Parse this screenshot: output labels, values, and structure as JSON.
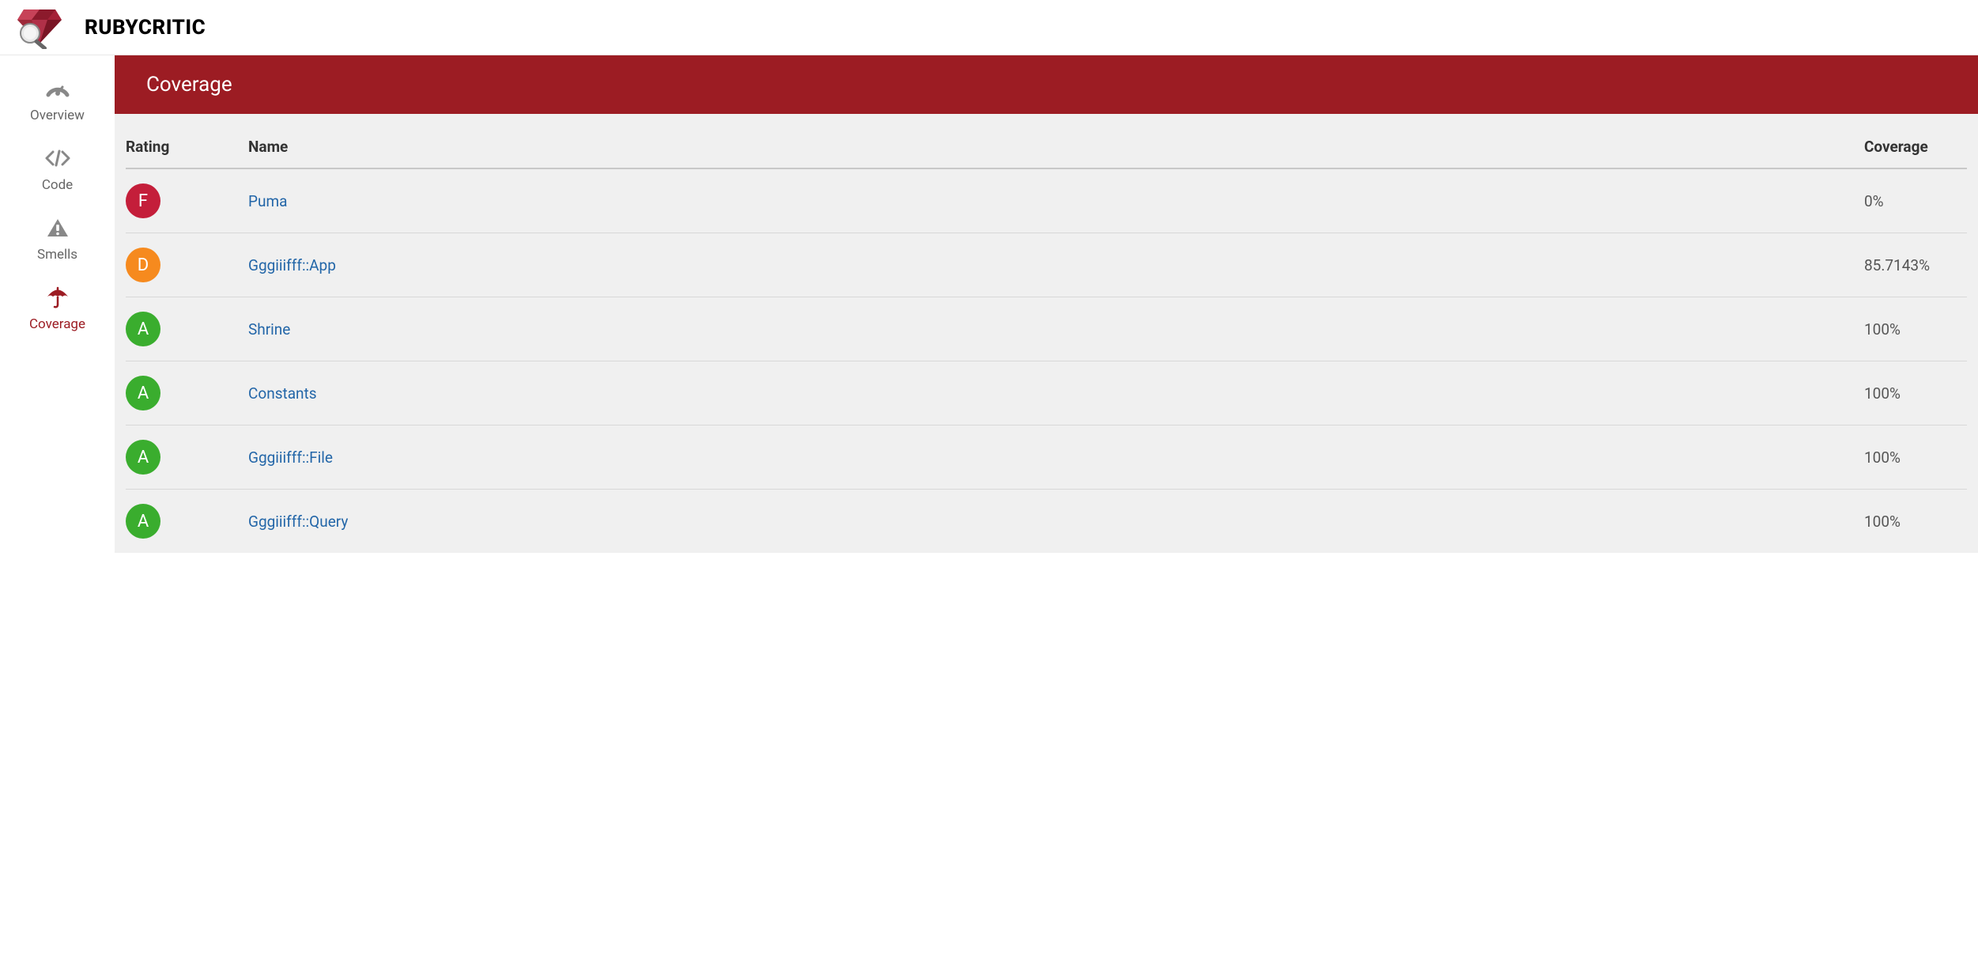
{
  "header": {
    "title": "RUBYCRITIC"
  },
  "sidebar": {
    "items": [
      {
        "label": "Overview",
        "icon": "gauge-icon",
        "active": false
      },
      {
        "label": "Code",
        "icon": "code-icon",
        "active": false
      },
      {
        "label": "Smells",
        "icon": "warning-icon",
        "active": false
      },
      {
        "label": "Coverage",
        "icon": "umbrella-icon",
        "active": true
      }
    ]
  },
  "page": {
    "title": "Coverage"
  },
  "table": {
    "headers": {
      "rating": "Rating",
      "name": "Name",
      "coverage": "Coverage"
    },
    "rows": [
      {
        "rating": "F",
        "name": "Puma",
        "coverage": "0%"
      },
      {
        "rating": "D",
        "name": "Gggiiifff::App",
        "coverage": "85.7143%"
      },
      {
        "rating": "A",
        "name": "Shrine",
        "coverage": "100%"
      },
      {
        "rating": "A",
        "name": "Constants",
        "coverage": "100%"
      },
      {
        "rating": "A",
        "name": "Gggiiifff::File",
        "coverage": "100%"
      },
      {
        "rating": "A",
        "name": "Gggiiifff::Query",
        "coverage": "100%"
      }
    ]
  }
}
